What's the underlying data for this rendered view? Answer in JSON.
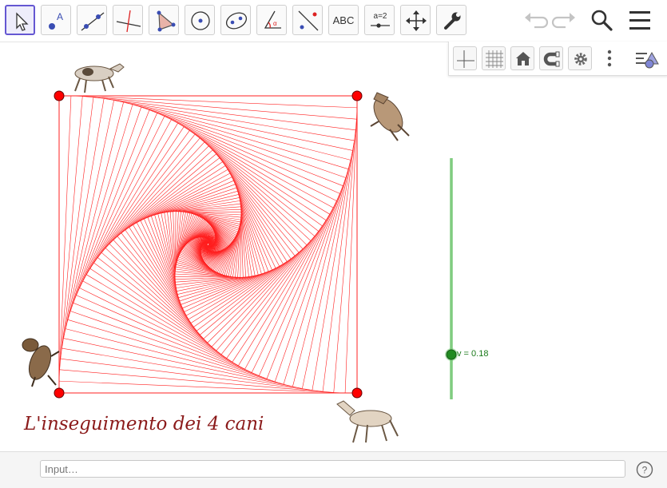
{
  "toolbar": {
    "tools": [
      {
        "name": "move-tool",
        "icon": "pointer-icon"
      },
      {
        "name": "point-tool",
        "icon": "point-icon"
      },
      {
        "name": "line-tool",
        "icon": "line-icon"
      },
      {
        "name": "perpendicular-line-tool",
        "icon": "perpendicular-icon"
      },
      {
        "name": "polygon-tool",
        "icon": "polygon-icon"
      },
      {
        "name": "circle-tool",
        "icon": "circle-icon"
      },
      {
        "name": "ellipse-tool",
        "icon": "ellipse-icon"
      },
      {
        "name": "angle-tool",
        "icon": "angle-icon"
      },
      {
        "name": "reflect-tool",
        "icon": "reflect-icon"
      },
      {
        "name": "text-tool",
        "icon": "text-icon",
        "label": "ABC"
      },
      {
        "name": "slider-tool",
        "icon": "slider-icon",
        "label": "a=2"
      },
      {
        "name": "move-graphics-tool",
        "icon": "move-arrows-icon"
      },
      {
        "name": "settings-tool",
        "icon": "wrench-icon"
      }
    ],
    "active_tool": "move-tool",
    "right": [
      "undo-icon",
      "redo-icon",
      "search-icon",
      "menu-icon"
    ]
  },
  "style_bar": {
    "buttons": [
      "axes-icon",
      "grid-icon",
      "home-icon",
      "magnet-icon",
      "gear-icon",
      "more-icon",
      "style-bar-toggle-icon"
    ]
  },
  "graphics": {
    "title": "L'inseguimento dei 4 cani",
    "slider_label": "v = 0.18",
    "slider_value": 0.18,
    "line_color": "#ff2020",
    "point_color": "#ff0000",
    "slider_color": "#7fcc7f",
    "slider_knob_color": "#228b22",
    "images": [
      "dog-top-left",
      "dog-top-right",
      "dog-bottom-left",
      "dog-bottom-right"
    ]
  },
  "input_bar": {
    "placeholder": "Input…",
    "help_icon": "help-icon"
  },
  "colors": {
    "accent": "#6557d2",
    "title": "#8b1a1a"
  }
}
